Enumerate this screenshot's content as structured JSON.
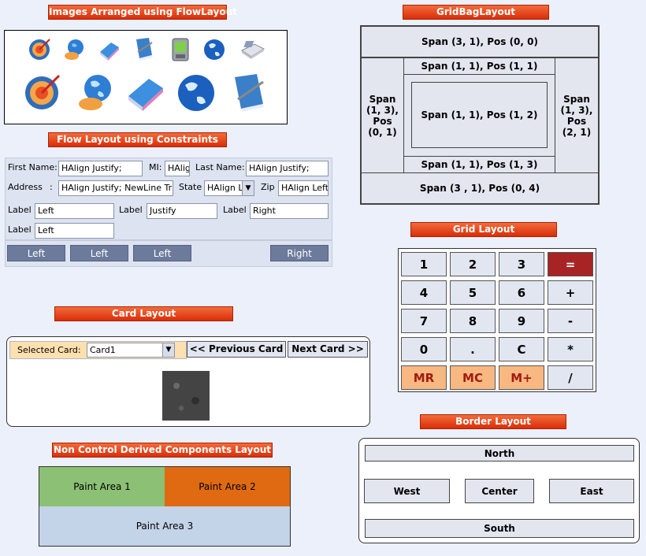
{
  "flow_images": {
    "title": "Images Arranged using FlowLayout",
    "icons": [
      "target-icon",
      "globe-hand-icon",
      "drive-icon",
      "book-icon",
      "pda-icon",
      "globe-icon",
      "fax-icon",
      "target-icon",
      "globe-hand-icon",
      "drive-icon",
      "globe-icon",
      "book-icon"
    ]
  },
  "flow_constraints": {
    "title": "Flow Layout using Constraints",
    "first_name_label": "First Name:",
    "first_name_value": "HAlign Justify;",
    "mi_label": "MI:",
    "mi_value": "HAlig",
    "last_name_label": "Last Name:",
    "last_name_value": "HAlign Justify;",
    "address_label": "Address",
    "address_colon": ":",
    "address_value": "HAlign Justify; NewLine True;",
    "state_label": "State",
    "state_value": "HAlign L",
    "zip_label": "Zip",
    "zip_value": "HAlign Left",
    "label1": "Label",
    "value1": "Left",
    "label2": "Label",
    "value2": "Justify",
    "label3": "Label",
    "value3": "Right",
    "label4": "Label",
    "value4": "Left",
    "buttons": [
      "Left",
      "Left",
      "Left",
      "Right"
    ]
  },
  "card_layout": {
    "title": "Card Layout",
    "selected_label": "Selected Card:",
    "selected_value": "Card1",
    "prev_button": "<< Previous Card",
    "next_button": "Next Card >>"
  },
  "non_control": {
    "title": "Non Control Derived Components Layout",
    "area1": "Paint Area 1",
    "area2": "Paint Area 2",
    "area3": "Paint Area 3",
    "colors": {
      "area1": "#8cc074",
      "area2": "#e06a12",
      "area3": "#c4d4e8"
    }
  },
  "gridbag": {
    "title": "GridBagLayout",
    "top": "Span (3, 1), Pos (0, 0)",
    "left": "Span (1, 3), Pos (0, 1)",
    "mid_top": "Span (1, 1), Pos (1, 1)",
    "center": "Span (1, 1), Pos (1, 2)",
    "mid_bottom": "Span (1, 1), Pos (1, 3)",
    "right": "Span (1, 3), Pos (2, 1)",
    "bottom": "Span (3 , 1), Pos (0, 4)"
  },
  "grid_layout": {
    "title": "Grid Layout",
    "keys": [
      "1",
      "2",
      "3",
      "=",
      "4",
      "5",
      "6",
      "+",
      "7",
      "8",
      "9",
      "-",
      "0",
      ".",
      "C",
      "*",
      "MR",
      "MC",
      "M+",
      "/"
    ],
    "colors": {
      "equals": "#a82424",
      "memory": "#f7b882",
      "memory_text": "#a31a12"
    }
  },
  "border_layout": {
    "title": "Border Layout",
    "north": "North",
    "west": "West",
    "center": "Center",
    "east": "East",
    "south": "South"
  }
}
